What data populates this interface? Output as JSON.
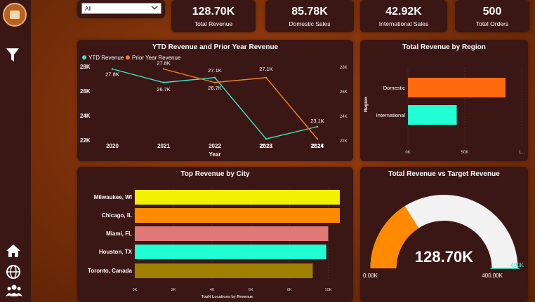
{
  "filter": {
    "value": "All"
  },
  "kpis": [
    {
      "value": "128.70K",
      "label": "Total Revenue"
    },
    {
      "value": "85.78K",
      "label": "Domestic Sales"
    },
    {
      "value": "42.92K",
      "label": "International Sales"
    },
    {
      "value": "500",
      "label": "Total Orders"
    }
  ],
  "colors": {
    "ytd": "#3ce4c4",
    "prior": "#f0821e",
    "domestic": "#ff6a10",
    "international": "#22ffd4",
    "gauge_fill": "#ff8a00",
    "gauge_bg": "#f2f2f2"
  },
  "chart_data": [
    {
      "type": "line",
      "title": "YTD Revenue and Prior Year Revenue",
      "xlabel": "Year",
      "x": [
        "2020",
        "2021",
        "2022",
        "2023",
        "2024"
      ],
      "series": [
        {
          "name": "YTD Revenue",
          "values": [
            27.8,
            26.7,
            27.1,
            22.1,
            23.1
          ],
          "labels": [
            "27.8K",
            "26.7K",
            "27.1K",
            "22.1K",
            "23.1K"
          ]
        },
        {
          "name": "Prior Year Revenue",
          "values": [
            null,
            27.8,
            26.7,
            27.1,
            22.1
          ],
          "labels": [
            "",
            "27.8K",
            "26.7K",
            "27.1K",
            "22.1K"
          ]
        }
      ],
      "yticks": [
        "22K",
        "24K",
        "26K",
        "28K"
      ],
      "yticks_right": [
        "22K",
        "24K",
        "26K",
        "28K"
      ],
      "ylim": [
        22,
        28
      ]
    },
    {
      "type": "bar",
      "orientation": "horizontal",
      "title": "Total Revenue by Region",
      "ylabel": "Region",
      "categories": [
        "Domestic",
        "International"
      ],
      "values": [
        85.78,
        42.92
      ],
      "xticks": [
        "0K",
        "50K",
        "1..."
      ],
      "xlim": [
        0,
        100
      ]
    },
    {
      "type": "bar",
      "orientation": "horizontal",
      "title": "Top Revenue by City",
      "xlabel": "TopN Locations by Revenue",
      "categories": [
        "Milwaukee, WI",
        "Chicago, IL",
        "Miami, FL",
        "Houston, TX",
        "Toronto, Canada"
      ],
      "values": [
        10.6,
        10.6,
        10.0,
        9.9,
        9.2
      ],
      "colors": [
        "#f2f200",
        "#ff8c00",
        "#e07878",
        "#22ffd4",
        "#a08000"
      ],
      "xticks": [
        "0K",
        "2K",
        "4K",
        "6K",
        "8K",
        "10K"
      ],
      "xlim": [
        0,
        11
      ]
    },
    {
      "type": "gauge",
      "title": "Total Revenue vs Target Revenue",
      "value": 128.7,
      "value_label": "128.70K",
      "min_label": "0.00K",
      "max_label": "400.00K",
      "target_label": "400K",
      "min": 0,
      "max": 400
    }
  ]
}
